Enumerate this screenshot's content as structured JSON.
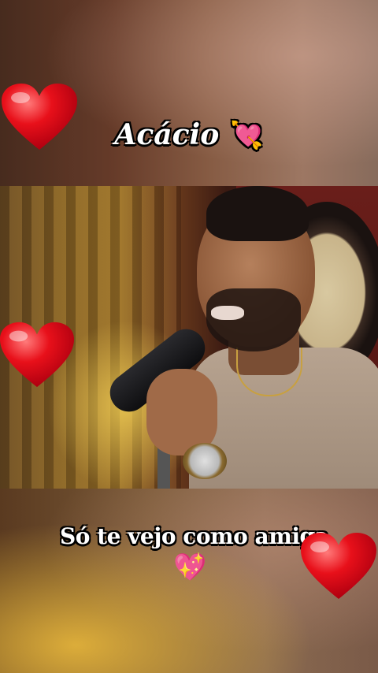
{
  "overlay": {
    "title": "Acácio",
    "title_emoji": "💘",
    "caption": "Só te vejo como amiga",
    "caption_emoji": "💖"
  },
  "colors": {
    "heart": "#e8101a",
    "heart_highlight": "#ff7a7a",
    "text": "#ffffff",
    "text_outline": "#000000"
  },
  "icons": [
    "heart-icon",
    "heart-with-arrow-emoji",
    "sparkling-heart-emoji"
  ]
}
